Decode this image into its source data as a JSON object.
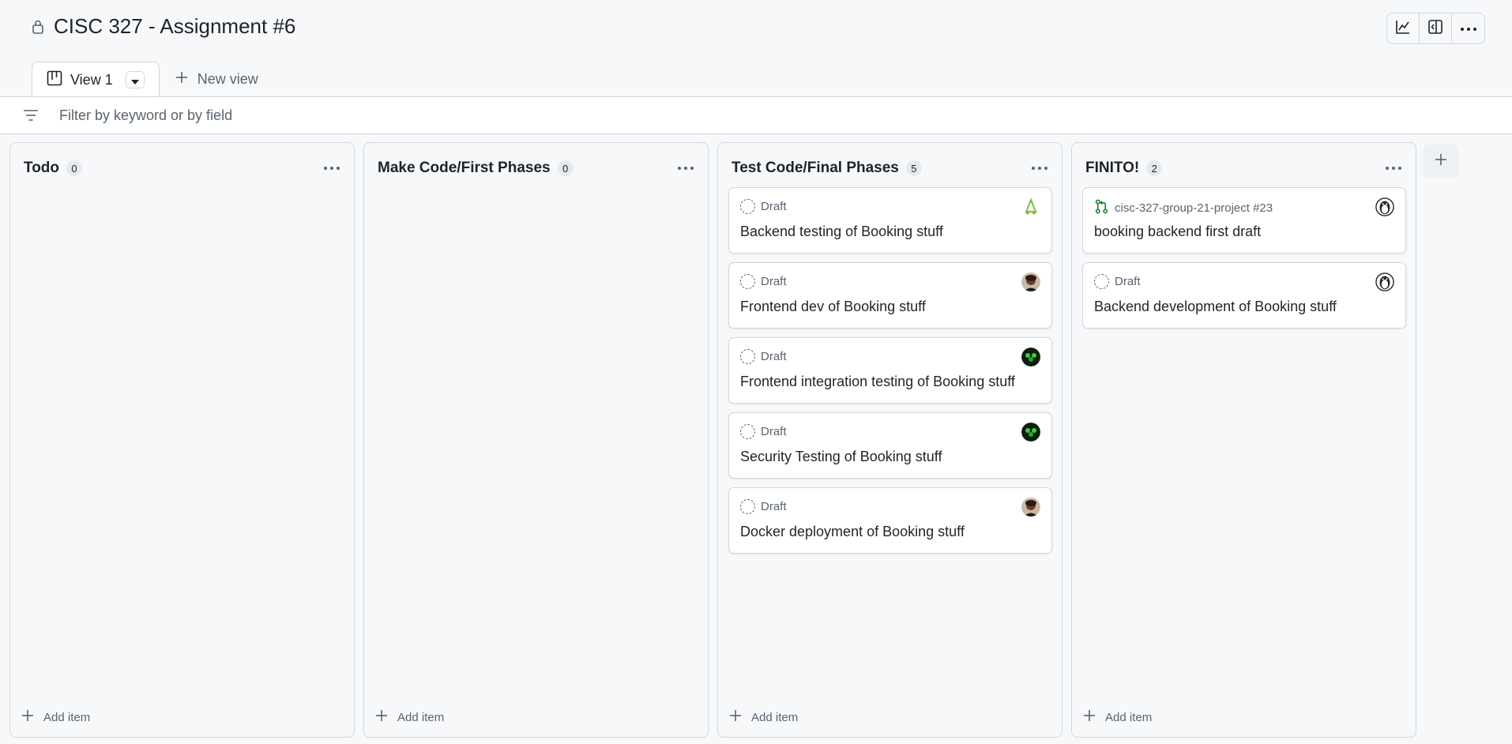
{
  "header": {
    "title": "CISC 327 - Assignment #6",
    "buttons": [
      "insights-icon",
      "panel-icon",
      "more-icon"
    ]
  },
  "tabs": {
    "active": "View 1",
    "new_view": "New view"
  },
  "filter": {
    "placeholder": "Filter by keyword or by field"
  },
  "columns": [
    {
      "name": "Todo",
      "count": "0",
      "add_label": "Add item",
      "cards": []
    },
    {
      "name": "Make Code/First Phases",
      "count": "0",
      "add_label": "Add item",
      "cards": []
    },
    {
      "name": "Test Code/Final Phases",
      "count": "5",
      "add_label": "Add item",
      "cards": [
        {
          "meta": "Draft",
          "title": "Backend testing of Booking stuff",
          "avatar": "linux-avatar"
        },
        {
          "meta": "Draft",
          "title": "Frontend dev of Booking stuff",
          "avatar": "person-avatar"
        },
        {
          "meta": "Draft",
          "title": "Frontend integration testing of Booking stuff",
          "avatar": "green-avatar"
        },
        {
          "meta": "Draft",
          "title": "Security Testing of Booking stuff",
          "avatar": "green-avatar"
        },
        {
          "meta": "Draft",
          "title": "Docker deployment of Booking stuff",
          "avatar": "person-avatar"
        }
      ]
    },
    {
      "name": "FINITO!",
      "count": "2",
      "add_label": "Add item",
      "cards": [
        {
          "meta": "cisc-327-group-21-project #23",
          "title": "booking backend first draft",
          "avatar": "penguin-avatar",
          "type": "pull-request"
        },
        {
          "meta": "Draft",
          "title": "Backend development of Booking stuff",
          "avatar": "penguin-avatar"
        }
      ]
    }
  ],
  "colors": {
    "background": "#f6f8fa",
    "border": "#d0d7de",
    "text": "#1f2328",
    "muted": "#59636e",
    "pr_green": "#1a7f37"
  }
}
